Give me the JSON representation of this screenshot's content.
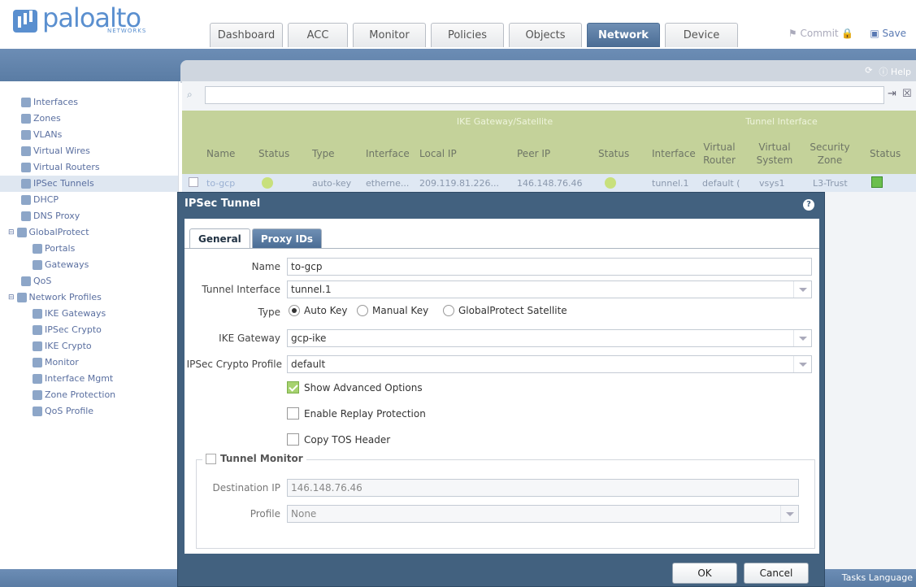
{
  "brand": {
    "name": "paloalto",
    "sub": "NETWORKS"
  },
  "tabs": [
    "Dashboard",
    "ACC",
    "Monitor",
    "Policies",
    "Objects",
    "Network",
    "Device"
  ],
  "active_tab": "Network",
  "top_actions": {
    "commit": "Commit",
    "save": "Save"
  },
  "help": {
    "label": "Help"
  },
  "sidebar": {
    "items": [
      {
        "label": "Interfaces",
        "indent": 0
      },
      {
        "label": "Zones",
        "indent": 0
      },
      {
        "label": "VLANs",
        "indent": 0
      },
      {
        "label": "Virtual Wires",
        "indent": 0
      },
      {
        "label": "Virtual Routers",
        "indent": 0
      },
      {
        "label": "IPSec Tunnels",
        "indent": 0,
        "selected": true
      },
      {
        "label": "DHCP",
        "indent": 0
      },
      {
        "label": "DNS Proxy",
        "indent": 0
      },
      {
        "label": "GlobalProtect",
        "indent": 0
      },
      {
        "label": "Portals",
        "indent": 1
      },
      {
        "label": "Gateways",
        "indent": 1
      },
      {
        "label": "QoS",
        "indent": 0
      },
      {
        "label": "Network Profiles",
        "indent": 0
      },
      {
        "label": "IKE Gateways",
        "indent": 1
      },
      {
        "label": "IPSec Crypto",
        "indent": 1
      },
      {
        "label": "IKE Crypto",
        "indent": 1
      },
      {
        "label": "Monitor",
        "indent": 1
      },
      {
        "label": "Interface Mgmt",
        "indent": 1
      },
      {
        "label": "Zone Protection",
        "indent": 1
      },
      {
        "label": "QoS Profile",
        "indent": 1
      }
    ]
  },
  "grid": {
    "groups": {
      "ike": "IKE Gateway/Satellite",
      "tunnel": "Tunnel Interface"
    },
    "columns": [
      "Name",
      "Status",
      "Type",
      "Interface",
      "Local IP",
      "Peer IP",
      "Status",
      "Interface",
      "Virtual Router",
      "Virtual System",
      "Security Zone",
      "Status"
    ],
    "row": {
      "name": "to-gcp",
      "type": "auto-key",
      "interface": "etherne...",
      "local_ip": "209.119.81.226...",
      "peer_ip": "146.148.76.46",
      "tunnel_if": "tunnel.1",
      "vrouter": "default (",
      "vsys": "vsys1",
      "zone": "L3-Trust"
    }
  },
  "dialog": {
    "title": "IPSec Tunnel",
    "tabs": [
      "General",
      "Proxy IDs"
    ],
    "labels": {
      "name": "Name",
      "tunnel_interface": "Tunnel Interface",
      "type": "Type",
      "ike_gateway": "IKE Gateway",
      "crypto_profile": "IPSec Crypto Profile",
      "destination_ip": "Destination IP",
      "profile": "Profile"
    },
    "values": {
      "name": "to-gcp",
      "tunnel_interface": "tunnel.1",
      "ike_gateway": "gcp-ike",
      "crypto_profile": "default",
      "destination_ip": "146.148.76.46",
      "profile": "None"
    },
    "type_options": [
      "Auto Key",
      "Manual Key",
      "GlobalProtect Satellite"
    ],
    "type_selected": "Auto Key",
    "checkboxes": [
      {
        "label": "Show Advanced Options",
        "checked": true
      },
      {
        "label": "Enable Replay Protection",
        "checked": false
      },
      {
        "label": "Copy TOS Header",
        "checked": false
      }
    ],
    "tunnel_monitor": {
      "label": "Tunnel Monitor",
      "checked": false
    },
    "buttons": {
      "ok": "OK",
      "cancel": "Cancel"
    }
  },
  "bottom": {
    "tasks": "Tasks",
    "language": "Language"
  }
}
